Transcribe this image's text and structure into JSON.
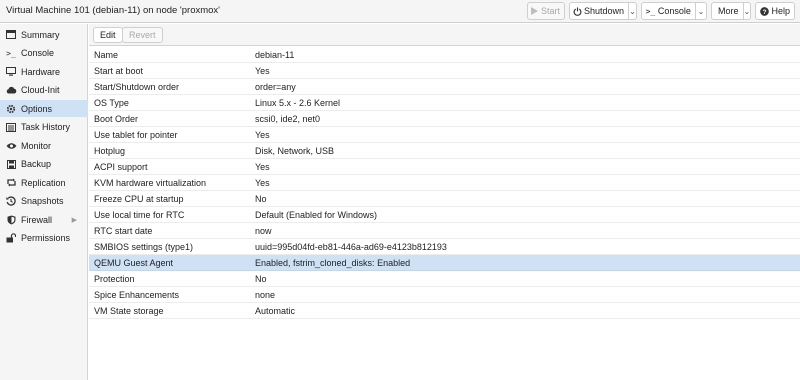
{
  "header": {
    "title": "Virtual Machine 101 (debian-11) on node 'proxmox'",
    "buttons": {
      "start": "Start",
      "shutdown": "Shutdown",
      "console": "Console",
      "more": "More",
      "help": "Help"
    }
  },
  "sidebar": {
    "items": [
      {
        "label": "Summary",
        "icon": "summary-icon"
      },
      {
        "label": "Console",
        "icon": "terminal-icon"
      },
      {
        "label": "Hardware",
        "icon": "monitor-icon"
      },
      {
        "label": "Cloud-Init",
        "icon": "cloud-icon"
      },
      {
        "label": "Options",
        "icon": "gear-icon",
        "active": true
      },
      {
        "label": "Task History",
        "icon": "list-icon"
      },
      {
        "label": "Monitor",
        "icon": "eye-icon"
      },
      {
        "label": "Backup",
        "icon": "save-icon"
      },
      {
        "label": "Replication",
        "icon": "retweet-icon"
      },
      {
        "label": "Snapshots",
        "icon": "history-icon"
      },
      {
        "label": "Firewall",
        "icon": "shield-icon"
      },
      {
        "label": "Permissions",
        "icon": "unlock-icon"
      }
    ]
  },
  "toolbar": {
    "edit": "Edit",
    "revert": "Revert"
  },
  "options": [
    {
      "name": "Name",
      "value": "debian-11"
    },
    {
      "name": "Start at boot",
      "value": "Yes"
    },
    {
      "name": "Start/Shutdown order",
      "value": "order=any"
    },
    {
      "name": "OS Type",
      "value": "Linux 5.x - 2.6 Kernel"
    },
    {
      "name": "Boot Order",
      "value": "scsi0, ide2, net0"
    },
    {
      "name": "Use tablet for pointer",
      "value": "Yes"
    },
    {
      "name": "Hotplug",
      "value": "Disk, Network, USB"
    },
    {
      "name": "ACPI support",
      "value": "Yes"
    },
    {
      "name": "KVM hardware virtualization",
      "value": "Yes"
    },
    {
      "name": "Freeze CPU at startup",
      "value": "No"
    },
    {
      "name": "Use local time for RTC",
      "value": "Default (Enabled for Windows)"
    },
    {
      "name": "RTC start date",
      "value": "now"
    },
    {
      "name": "SMBIOS settings (type1)",
      "value": "uuid=995d04fd-eb81-446a-ad69-e4123b812193"
    },
    {
      "name": "QEMU Guest Agent",
      "value": "Enabled, fstrim_cloned_disks: Enabled",
      "selected": true
    },
    {
      "name": "Protection",
      "value": "No"
    },
    {
      "name": "Spice Enhancements",
      "value": "none"
    },
    {
      "name": "VM State storage",
      "value": "Automatic"
    }
  ],
  "colors": {
    "selection": "#cfe1f5",
    "panel_bg": "#f5f5f5",
    "border": "#cfcfcf"
  }
}
